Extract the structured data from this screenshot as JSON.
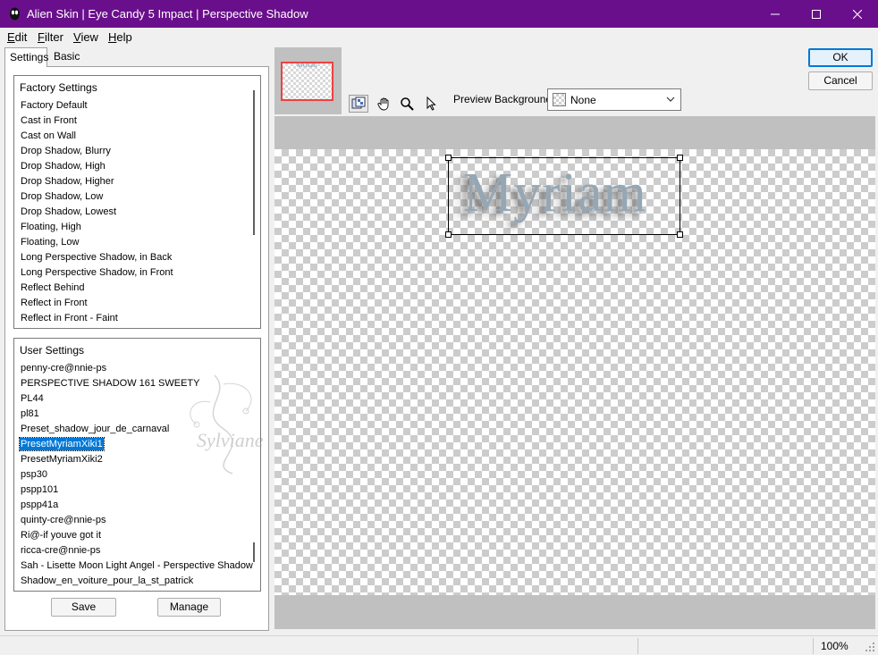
{
  "window": {
    "title": "Alien Skin | Eye Candy 5 Impact | Perspective Shadow",
    "accent_color": "#6a0f8c"
  },
  "menu": {
    "edit": {
      "first": "E",
      "rest": "dit"
    },
    "filter": {
      "first": "F",
      "rest": "ilter"
    },
    "view": {
      "first": "V",
      "rest": "iew"
    },
    "help": {
      "first": "H",
      "rest": "elp"
    }
  },
  "tabs": {
    "settings": "Settings",
    "basic": "Basic"
  },
  "factory": {
    "header": "Factory Settings",
    "items": [
      "Factory Default",
      "Cast in Front",
      "Cast on Wall",
      "Drop Shadow, Blurry",
      "Drop Shadow, High",
      "Drop Shadow, Higher",
      "Drop Shadow, Low",
      "Drop Shadow, Lowest",
      "Floating, High",
      "Floating, Low",
      "Long Perspective Shadow, in Back",
      "Long Perspective Shadow, in Front",
      "Reflect Behind",
      "Reflect in Front",
      "Reflect in Front - Faint"
    ]
  },
  "user": {
    "header": "User Settings",
    "items": [
      "penny-cre@nnie-ps",
      "PERSPECTIVE SHADOW 161 SWEETY",
      "PL44",
      "pl81",
      "Preset_shadow_jour_de_carnaval",
      "PresetMyriamXiki1",
      "PresetMyriamXiki2",
      "psp30",
      "pspp101",
      "pspp41a",
      "quinty-cre@nnie-ps",
      "Ri@-if youve got it",
      "ricca-cre@nnie-ps",
      "Sah - Lisette Moon Light Angel - Perspective Shadow",
      "Shadow_en_voiture_pour_la_st_patrick"
    ],
    "selected_index": 5
  },
  "buttons": {
    "save": "Save",
    "manage": "Manage",
    "ok": "OK",
    "cancel": "Cancel"
  },
  "preview": {
    "background_label": "Preview Background:",
    "background_value": "None",
    "thumbnail_text": "Myriam",
    "text": "Myriam"
  },
  "watermark": {
    "text": "Sylviane"
  },
  "status": {
    "zoom": "100%"
  }
}
